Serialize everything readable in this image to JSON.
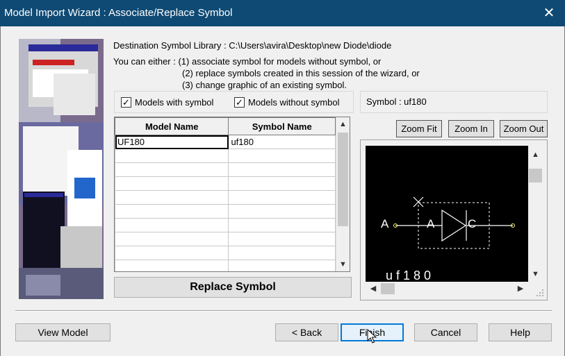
{
  "window": {
    "title": "Model Import Wizard : Associate/Replace Symbol",
    "close_glyph": "✕"
  },
  "header": {
    "destination_label": "Destination Symbol Library :",
    "destination_path": "C:\\Users\\avira\\Desktop\\new Diode\\diode",
    "either_lines": [
      "You can either :  (1) associate symbol for models without symbol, or",
      "(2) replace symbols created in this session of the wizard, or",
      "(3) change graphic of an existing symbol."
    ]
  },
  "filters": {
    "models_with_symbol": {
      "label": "Models with symbol",
      "checked": true
    },
    "models_without_symbol": {
      "label": "Models without symbol",
      "checked": true
    }
  },
  "symbol_panel": {
    "label": "Symbol : uf180"
  },
  "table": {
    "columns": [
      "Model Name",
      "Symbol Name"
    ],
    "rows": [
      [
        "UF180",
        "uf180"
      ],
      [
        "",
        ""
      ],
      [
        "",
        ""
      ],
      [
        "",
        ""
      ],
      [
        "",
        ""
      ],
      [
        "",
        ""
      ],
      [
        "",
        ""
      ],
      [
        "",
        ""
      ],
      [
        "",
        ""
      ],
      [
        "",
        ""
      ]
    ]
  },
  "replace_button": "Replace Symbol",
  "zoom": {
    "fit": "Zoom Fit",
    "in": "Zoom In",
    "out": "Zoom Out"
  },
  "preview": {
    "pin_left": "A",
    "anode_label": "A",
    "cathode_label": "C",
    "part_name": "u f 1 8 0",
    "stroke_color": "#ffffff",
    "pin_color": "#ffff66"
  },
  "footer": {
    "view_model": "View Model",
    "back": "< Back",
    "finish": "Finish",
    "cancel": "Cancel",
    "help": "Help"
  },
  "colors": {
    "titlebar": "#0e4a74",
    "dialog_bg": "#f0f0f0",
    "focus_border": "#0078d7"
  }
}
